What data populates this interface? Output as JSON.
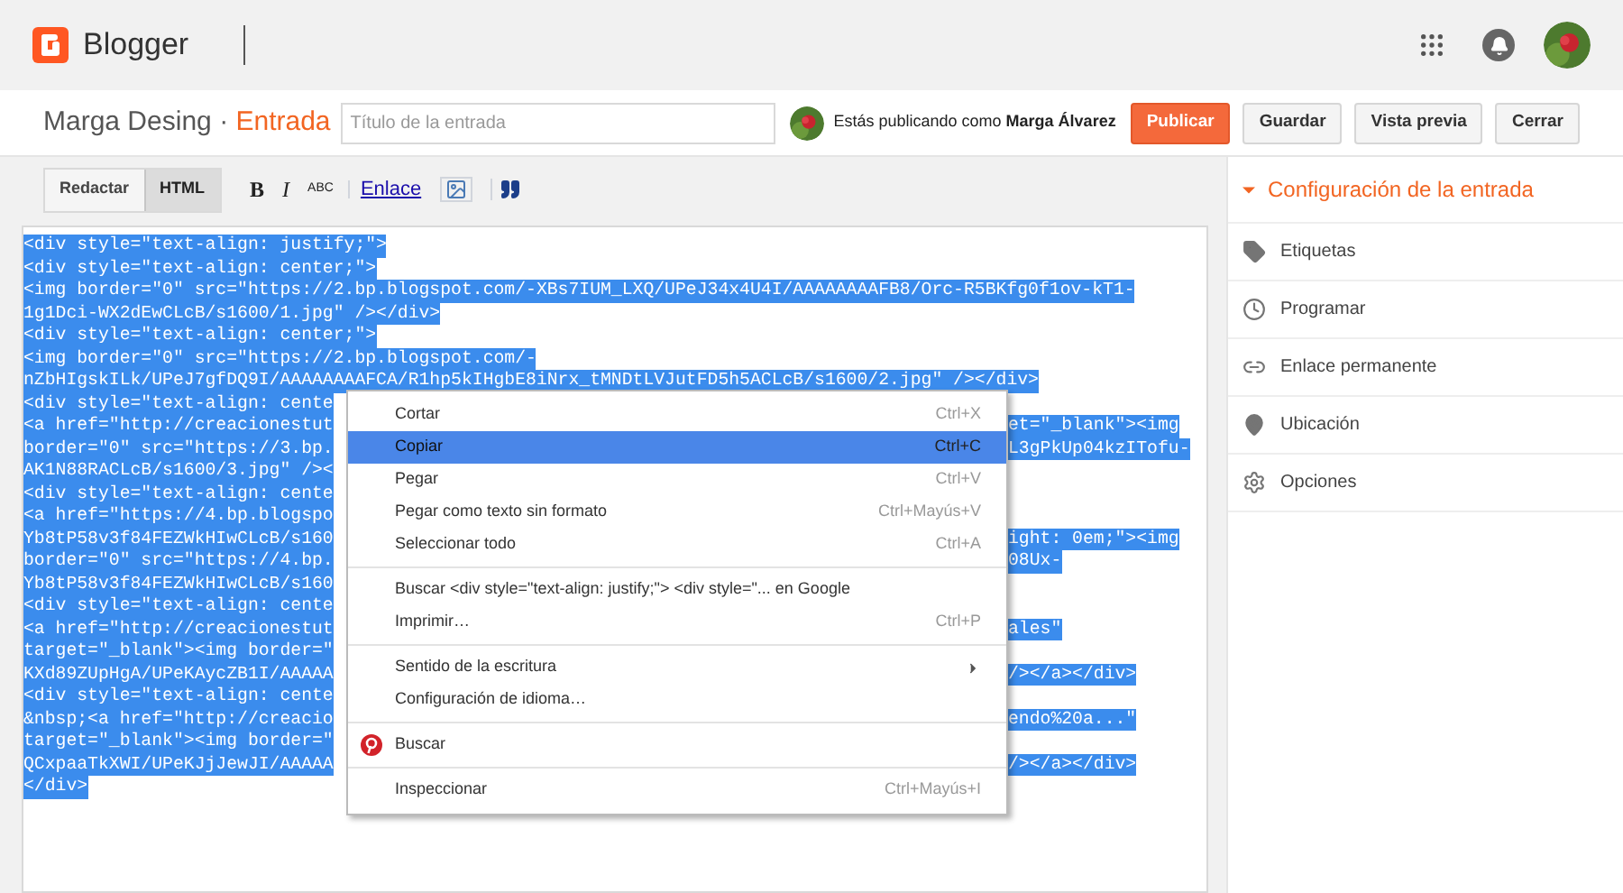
{
  "topbar": {
    "brand": "Blogger"
  },
  "post_header": {
    "blog": "Marga Desing",
    "separator": "·",
    "section": "Entrada",
    "title_field": {
      "placeholder": "Título de la entrada"
    },
    "publishing_as": "Estás publicando como **Marga Álvarez**",
    "buttons": [
      {
        "label": "Publicar",
        "kind": "primary"
      },
      {
        "label": "Guardar",
        "kind": "secondary"
      },
      {
        "label": "Vista previa",
        "kind": "secondary"
      },
      {
        "label": "Cerrar",
        "kind": "secondary"
      }
    ]
  },
  "mode_tabs": [
    {
      "label": "Redactar",
      "selected": false
    },
    {
      "label": "HTML",
      "selected": true
    }
  ],
  "format_toolbar": [
    {
      "kind": "bold",
      "label": "B"
    },
    {
      "kind": "italic",
      "label": "I"
    },
    {
      "kind": "strike",
      "label": "ABC"
    },
    {
      "kind": "link",
      "label": "Enlace"
    },
    {
      "kind": "image"
    },
    {
      "kind": "quote"
    }
  ],
  "code_lines": [
    {
      "text": "<div style=\"text-align: justify;\">"
    },
    {
      "text": "<div style=\"text-align: center;\">"
    },
    {
      "text": "<img border=\"0\" src=\"https://2.bp.blogspot.com/-XBs7IUM_LXQ/UPeJ34x4U4I/AAAAAAAAFB8/Orc-R5BKfg0f1ov-kT1-"
    },
    {
      "text": "1g1Dci-WX2dEwCLcB/s1600/1.jpg\" /></div>"
    },
    {
      "text": "<div style=\"text-align: center;\">"
    },
    {
      "text": "<img border=\"0\" src=\"https://2.bp.blogspot.com/-"
    },
    {
      "text": "nZbHIgskILk/UPeJ7gfDQ9I/AAAAAAAAFCA/R1hp5kIHgbE8iNrx_tMNDtLVJutFD5h5ACLcB/s1600/2.jpg\" /></div>"
    },
    {
      "text": "<div style=\"text-align: cente"
    },
    {
      "text": "<a href=\"http://creacionestut",
      "text_right": "et=\"_blank\"><img"
    },
    {
      "text": "border=\"0\" src=\"https://3.bp.",
      "text_right": "L3gPkUp04kzITofu-"
    },
    {
      "text": "AK1N88RACLcB/s1600/3.jpg\" /><"
    },
    {
      "text": "<div style=\"text-align: cente"
    },
    {
      "text": "<a href=\"https://4.bp.blogspo"
    },
    {
      "text": "Yb8tP58v3f84FEZWkHIwCLcB/s160",
      "text_right": "ight: 0em;\"><img"
    },
    {
      "text": "border=\"0\" src=\"https://4.bp.",
      "text_right": "08Ux-"
    },
    {
      "text": "Yb8tP58v3f84FEZWkHIwCLcB/s160"
    },
    {
      "text": "<div style=\"text-align: cente"
    },
    {
      "text": "<a href=\"http://creacionestut",
      "text_right": "ales\""
    },
    {
      "text": "target=\"_blank\"><img border=\""
    },
    {
      "text": "KXd89ZUpHgA/UPeKAycZB1I/AAAAA",
      "text_right": "/></a></div>"
    },
    {
      "text": "<div style=\"text-align: cente"
    },
    {
      "text": "&nbsp;<a href=\"http://creacio",
      "text_right": "endo%20a...\""
    },
    {
      "text": "target=\"_blank\"><img border=\""
    },
    {
      "text": "QCxpaaTkXWI/UPeKJjJewJI/AAAAA",
      "text_right": "/></a></div>"
    },
    {
      "text": "</div>"
    }
  ],
  "context_menu": [
    [
      {
        "label": "Cortar",
        "shortcut": "Ctrl+X",
        "selected": false
      },
      {
        "label": "Copiar",
        "shortcut": "Ctrl+C",
        "selected": true
      },
      {
        "label": "Pegar",
        "shortcut": "Ctrl+V",
        "selected": false
      },
      {
        "label": "Pegar como texto sin formato",
        "shortcut": "Ctrl+Mayús+V",
        "selected": false
      },
      {
        "label": "Seleccionar todo",
        "shortcut": "Ctrl+A",
        "selected": false
      }
    ],
    [
      {
        "label": "Buscar <div style=\"text-align: justify;\"> <div style=\"... en Google",
        "selected": false
      },
      {
        "label": "Imprimir…",
        "shortcut": "Ctrl+P",
        "selected": false
      }
    ],
    [
      {
        "label": "Sentido de la escritura",
        "submenu": true,
        "selected": false
      },
      {
        "label": "Configuración de idioma…",
        "selected": false
      }
    ],
    [
      {
        "label": "Buscar",
        "kind": "pin",
        "selected": false
      }
    ],
    [
      {
        "label": "Inspeccionar",
        "shortcut": "Ctrl+Mayús+I",
        "selected": false
      }
    ]
  ],
  "sidebar": {
    "heading": "Configuración de la entrada",
    "expanded": true,
    "items": [
      {
        "label": "Etiquetas",
        "kind": "tag"
      },
      {
        "label": "Programar",
        "kind": "clock"
      },
      {
        "label": "Enlace permanente",
        "kind": "link"
      },
      {
        "label": "Ubicación",
        "kind": "pin"
      },
      {
        "label": "Opciones",
        "kind": "gear"
      }
    ]
  }
}
